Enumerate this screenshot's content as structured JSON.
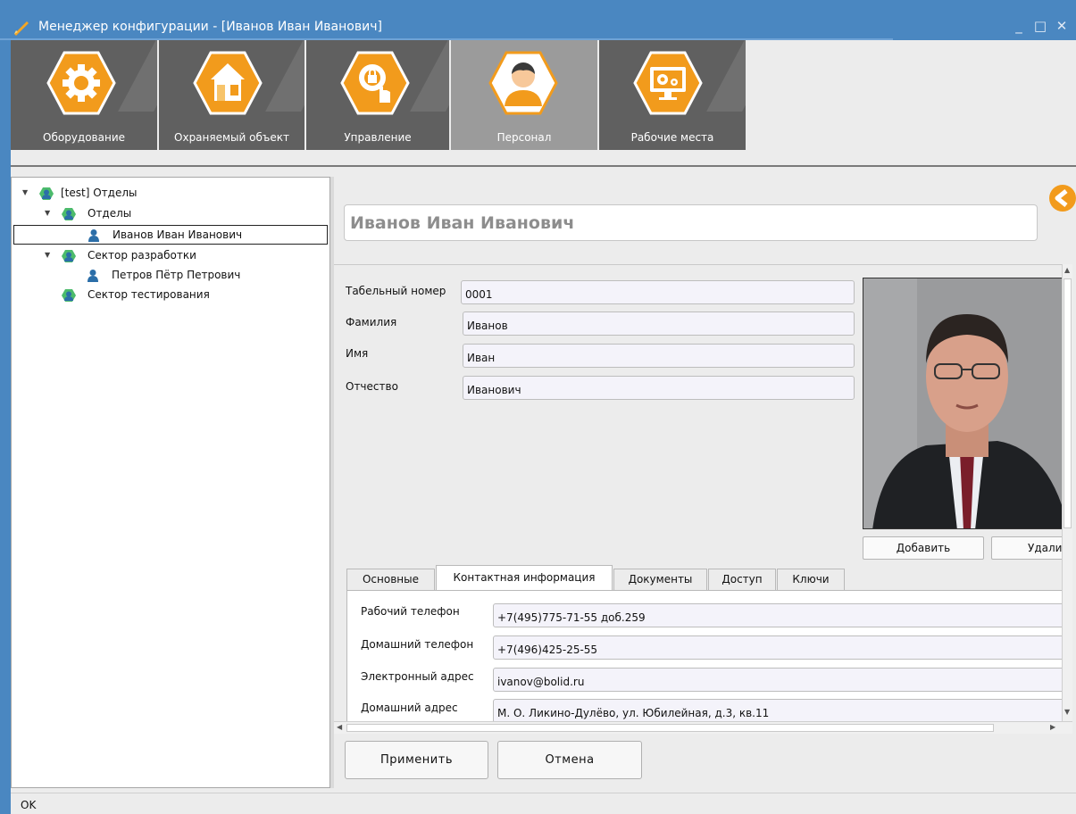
{
  "window": {
    "title": "Менеджер конфигурации - [Иванов Иван Иванович]",
    "controls": {
      "minimize": "_",
      "maximize": "□",
      "close": "✕"
    }
  },
  "colors": {
    "titlebar": "#4a87c1",
    "accent_orange": "#f29b1c",
    "toolbar_bg": "#606060",
    "toolbar_active": "#9b9b9b"
  },
  "toolbar": {
    "items": [
      {
        "label": "Оборудование",
        "icon": "gear-icon"
      },
      {
        "label": "Охраняемый объект",
        "icon": "house-icon"
      },
      {
        "label": "Управление",
        "icon": "lock-gear-hand-icon"
      },
      {
        "label": "Персонал",
        "icon": "person-icon",
        "active": true
      },
      {
        "label": "Рабочие места",
        "icon": "monitor-gears-icon"
      }
    ]
  },
  "tree": {
    "root": "[test] Отделы",
    "items": [
      {
        "label": "Отделы",
        "type": "group"
      },
      {
        "label": "Иванов Иван Иванович",
        "type": "person",
        "selected": true
      },
      {
        "label": "Сектор разработки",
        "type": "group"
      },
      {
        "label": "Петров Пётр Петрович",
        "type": "person"
      },
      {
        "label": "Сектор тестирования",
        "type": "group"
      }
    ]
  },
  "header": {
    "name": "Иванов Иван Иванович"
  },
  "form": {
    "tab_number_label": "Табельный номер",
    "tab_number_value": "0001",
    "surname_label": "Фамилия",
    "surname_value": "Иванов",
    "name_label": "Имя",
    "name_value": "Иван",
    "patronymic_label": "Отчество",
    "patronymic_value": "Иванович"
  },
  "photo": {
    "add_button": "Добавить",
    "delete_button": "Удали"
  },
  "tabs": [
    {
      "label": "Основные"
    },
    {
      "label": "Контактная информация",
      "active": true
    },
    {
      "label": "Документы"
    },
    {
      "label": "Доступ"
    },
    {
      "label": "Ключи"
    }
  ],
  "contact": {
    "work_phone_label": "Рабочий телефон",
    "work_phone_value": "+7(495)775-71-55 доб.259",
    "home_phone_label": "Домашний телефон",
    "home_phone_value": "+7(496)425-25-55",
    "email_label": "Электронный адрес",
    "email_value": "ivanov@bolid.ru",
    "address_label": "Домашний адрес",
    "address_value": "М. О. Ликино-Дулёво, ул. Юбилейная, д.3, кв.11"
  },
  "actions": {
    "apply": "Применить",
    "cancel": "Отмена"
  },
  "status": {
    "text": "OK"
  }
}
